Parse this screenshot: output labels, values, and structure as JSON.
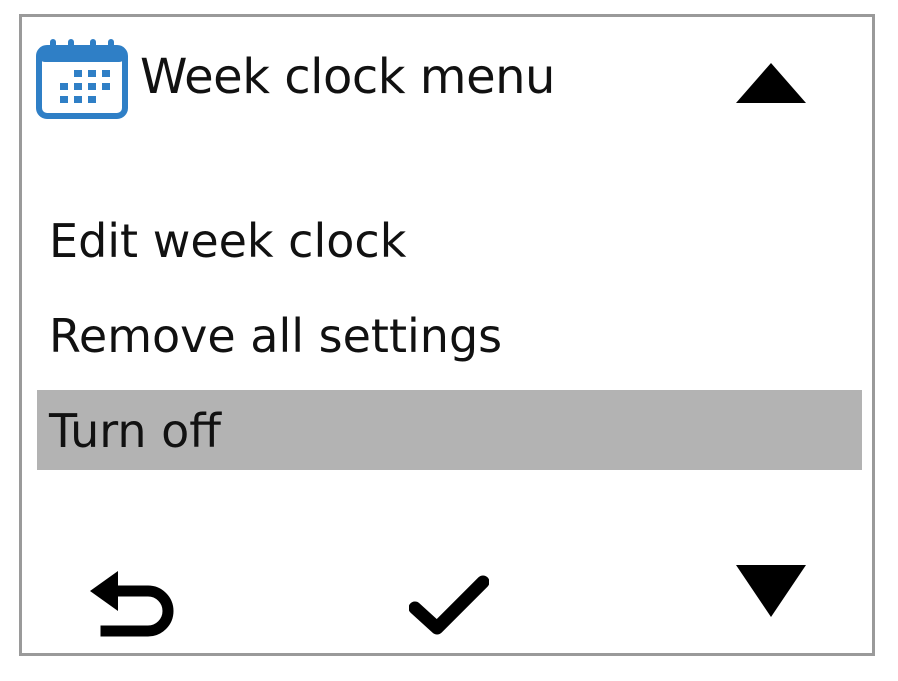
{
  "header": {
    "title": "Week clock menu",
    "icon": "calendar-icon"
  },
  "menu": {
    "items": [
      {
        "label": "Edit week clock",
        "selected": false
      },
      {
        "label": "Remove all settings",
        "selected": false
      },
      {
        "label": "Turn off",
        "selected": true
      }
    ]
  },
  "footer": {
    "back_icon": "back-arrow-icon",
    "confirm_icon": "checkmark-icon",
    "down_icon": "arrow-down-icon"
  },
  "colors": {
    "accent": "#2f7fc6",
    "selection": "#b3b3b3",
    "frame": "#9a9a9a",
    "text": "#111111"
  }
}
